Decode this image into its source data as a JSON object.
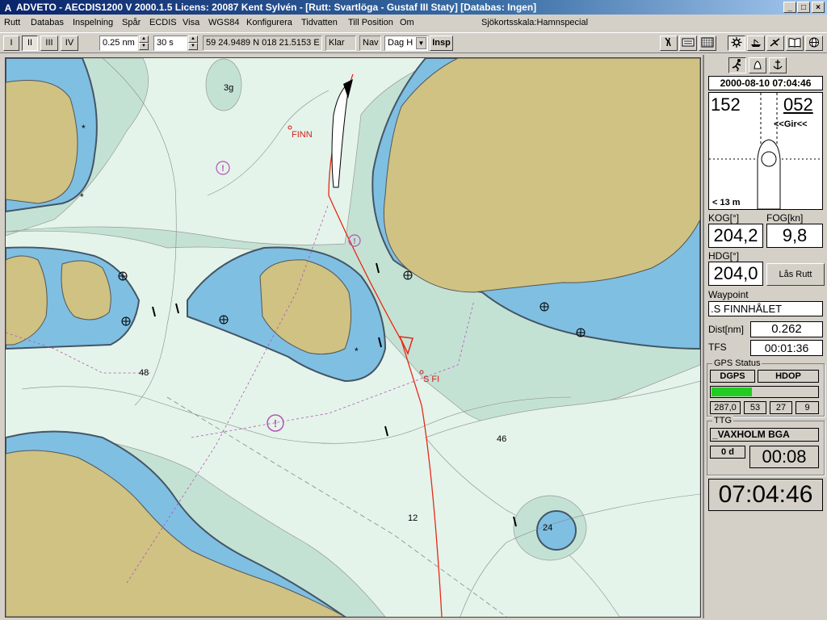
{
  "window": {
    "title": "ADVETO - AECDIS1200 V 2000.1.5  Licens: 20087 Kent Sylvén - [Rutt: Svartlöga - Gustaf III Staty] [Databas: Ingen]",
    "app_icon": "A",
    "controls": [
      "_",
      "□",
      "×"
    ]
  },
  "menu": {
    "items": [
      "Rutt",
      "Databas",
      "Inspelning",
      "Spår",
      "ECDIS",
      "Visa",
      "WGS84",
      "Konfigurera",
      "Tidvatten",
      "Till Position",
      "Om"
    ],
    "chart_scale": "Sjökortsskala:Hamnspecial"
  },
  "toolbar": {
    "mode_buttons": [
      "I",
      "II",
      "III",
      "IV"
    ],
    "range_value": "0.25 nm",
    "interval_value": "30 s",
    "position": "59 24.9489 N  018 21.5153 E",
    "status": "Klar",
    "nav": "Nav",
    "display_mode": "Dag H",
    "insp": "Insp",
    "right_icons": [
      "wrench-icon",
      "list-icon",
      "grid-icon",
      "gear-icon",
      "ship-icon",
      "plane-icon",
      "book-icon",
      "globe-icon"
    ]
  },
  "chart": {
    "place_labels": [
      "FINN",
      "S FI"
    ],
    "depths": [
      "3g",
      "48",
      "46",
      "12",
      "24"
    ]
  },
  "panel": {
    "tabs": [
      "run-icon",
      "bell-icon",
      "anchor-icon"
    ],
    "datetime": "2000-08-10 07:04:46",
    "heading_left": "152",
    "heading_right": "052",
    "turn_label": "<<Gir<<",
    "distance_label": "< 13 m",
    "kog_label": "KOG[°]",
    "kog_value": "204,2",
    "fog_label": "FOG[kn]",
    "fog_value": "9,8",
    "hdg_label": "HDG[°]",
    "hdg_value": "204,0",
    "lock_route": "Lås Rutt",
    "waypoint_label": "Waypoint",
    "waypoint_value": ".S FINNHÅLET",
    "dist_label": "Dist[nm]",
    "dist_value": "0.262",
    "tfs_label": "TFS",
    "tfs_value": "00:01:36",
    "gps_status_label": "GPS Status",
    "gps_mode": "DGPS",
    "gps_hdop": "HDOP",
    "gps_signal_level": 0.38,
    "gps_values": [
      "287,0",
      "53",
      "27",
      "9"
    ],
    "ttg_label": "TTG",
    "ttg_target": "_VAXHOLM BGA",
    "ttg_days": "0 d",
    "ttg_time": "00:08",
    "clock": "07:04:46"
  },
  "colors": {
    "land": "#cfc283",
    "shallow_water": "#7fbfe2",
    "mid_water": "#c4e2d4",
    "deep_water": "#e4f4ea",
    "route": "#e8281a",
    "hazard": "#b455b4",
    "gps_bar": "#22cc22"
  }
}
